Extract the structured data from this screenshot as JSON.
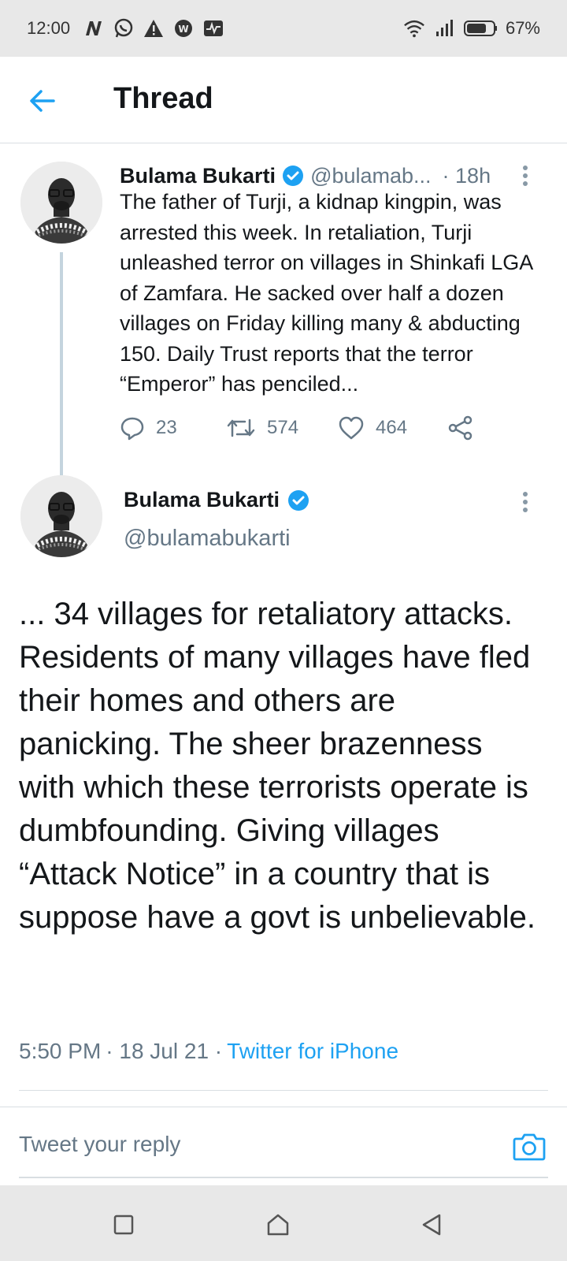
{
  "status_bar": {
    "time": "12:00",
    "battery_percent": "67%",
    "icons": [
      "n-icon",
      "whatsapp-icon",
      "warning-icon",
      "vpn-icon",
      "activity-icon",
      "wifi-icon",
      "signal-icon",
      "battery-icon"
    ]
  },
  "header": {
    "title": "Thread",
    "back_icon": "arrow-left-icon"
  },
  "tweet_parent": {
    "name": "Bulama Bukarti",
    "handle": "@bulamab...",
    "time": "· 18h",
    "text": "The father of Turji, a kidnap kingpin, was arrested this week. In retaliation, Turji unleashed terror on villages in Shinkafi LGA of Zamfara. He sacked over half a dozen villages on Friday killing many & abducting 150. Daily Trust reports that the terror “Emperor” has penciled...",
    "replies": "23",
    "retweets": "574",
    "likes": "464"
  },
  "tweet_main": {
    "name": "Bulama Bukarti",
    "handle": "@bulamabukarti",
    "text": "... 34 villages for retaliatory attacks. Residents of many villages have fled their homes and others are panicking. The sheer brazenness with which these terrorists operate is dumbfounding. Giving villages “Attack Notice” in a country that is suppose have a govt is unbelievable.",
    "time": "5:50 PM",
    "date": "· 18 Jul 21 ·",
    "source": "Twitter for iPhone"
  },
  "reply": {
    "placeholder": "Tweet your reply"
  },
  "colors": {
    "accent": "#1da1f2",
    "secondary_text": "#657786",
    "primary_text": "#14171a",
    "thread_line": "#c4d4de"
  }
}
